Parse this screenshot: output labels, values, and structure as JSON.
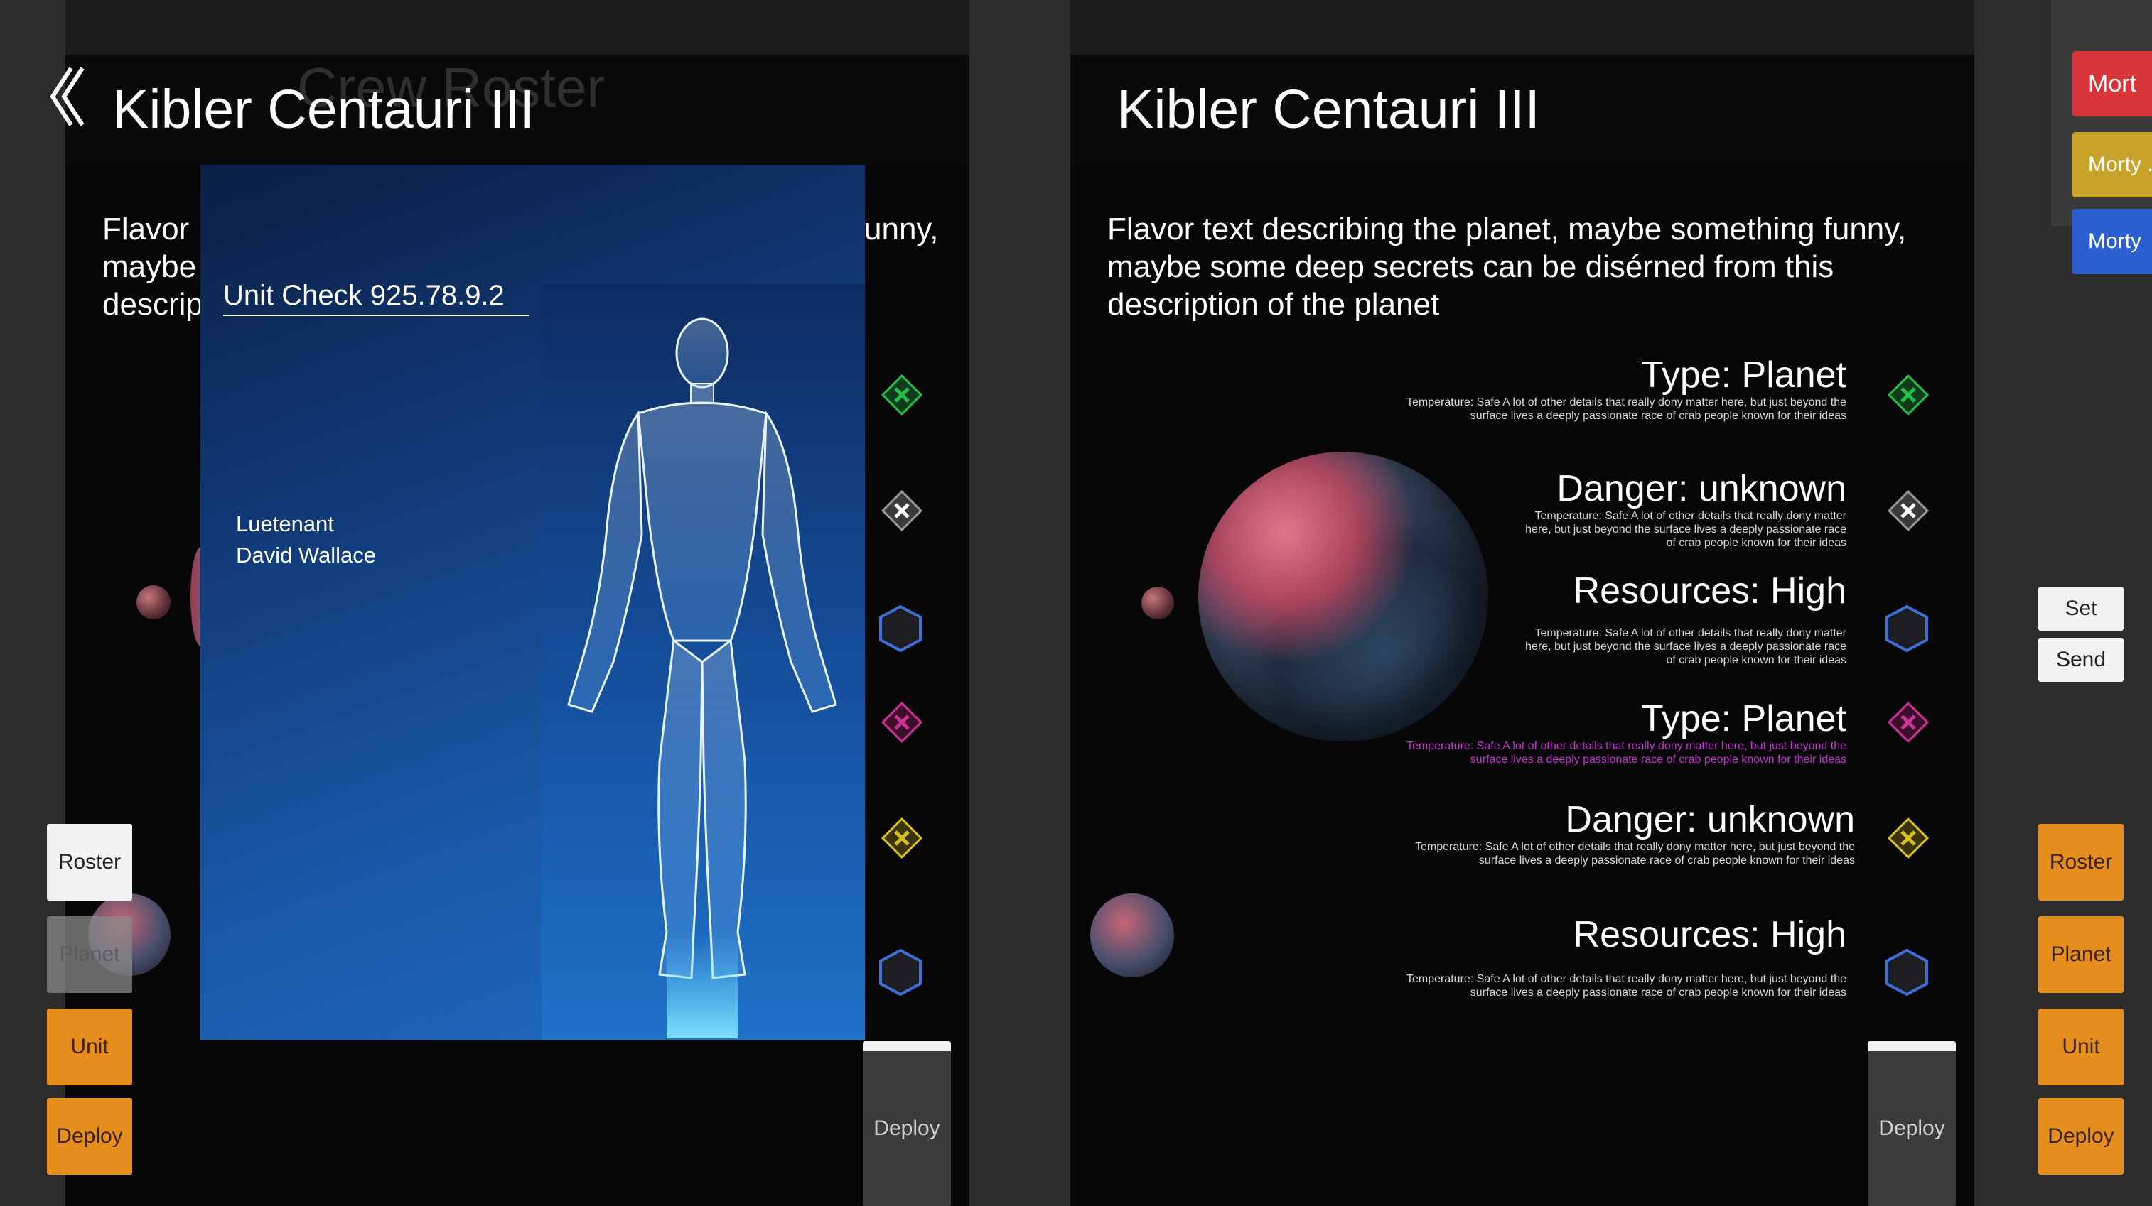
{
  "left_panel": {
    "ghost_title": "Crew Roster",
    "title": "Kibler Centauri III",
    "flavor_fragments": [
      "Flavor",
      "unny,",
      "maybe",
      "descrip"
    ]
  },
  "crew_card": {
    "unit_check": "Unit Check 925.78.9.2",
    "rank": "Luetenant",
    "name": "David Wallace"
  },
  "right_panel": {
    "title": "Kibler Centauri III",
    "flavor": "Flavor text describing the planet, maybe something funny, maybe some deep secrets can be disérned from this description of the planet",
    "items": [
      {
        "title": "Type: Planet",
        "detail": "Temperature: Safe A lot of other details that really dony matter here, but just beyond the surface lives a deeply passionate race of crab people known for their ideas",
        "accent": "#23c04a"
      },
      {
        "title": "Danger: unknown",
        "detail": "Temperature: Safe A lot of other details that really dony matter here, but just beyond the surface lives a deeply passionate race of crab people known for their ideas",
        "accent": "#cfcfcf"
      },
      {
        "title": "Resources: High",
        "detail": "Temperature: Safe A lot of other details that really dony matter here, but just beyond the surface lives a deeply passionate race of crab people known for their ideas",
        "accent": "#3d6fd8"
      },
      {
        "title": "Type: Planet",
        "detail": "Temperature: Safe A lot of other details that really dony matter here, but just beyond the surface lives a deeply passionate race of crab people known for their ideas",
        "accent": "#d0309a"
      },
      {
        "title": "Danger: unknown",
        "detail": "Temperature: Safe A lot of other details that really dony matter here, but just beyond the surface lives a deeply passionate race of crab people known for their ideas",
        "accent": "#d8c31c"
      },
      {
        "title": "Resources: High",
        "detail": "Temperature: Safe A lot of other details that really dony matter here, but just beyond the surface lives a deeply passionate race of crab people known for their ideas",
        "accent": "#3d6fd8"
      }
    ]
  },
  "left_buttons": {
    "roster": "Roster",
    "planet": "Planet",
    "unit": "Unit",
    "deploy": "Deploy"
  },
  "right_buttons": {
    "roster": "Roster",
    "planet": "Planet",
    "unit": "Unit",
    "deploy": "Deploy"
  },
  "deploy_columns": {
    "left": "Deploy",
    "right": "Deploy"
  },
  "side_controls": {
    "set": "Set",
    "send": "Send"
  },
  "morty_tags": [
    {
      "label": "Mort",
      "color": "#d8353a"
    },
    {
      "label": "Morty .",
      "color": "#c9a22a"
    },
    {
      "label": "Morty",
      "color": "#2b5fd0"
    }
  ],
  "icons": {
    "back": "chevrons-left-icon"
  },
  "colors": {
    "orange_button": "#e58e1e",
    "panel_bg": "#070707",
    "page_bg": "#2c2c2c"
  }
}
